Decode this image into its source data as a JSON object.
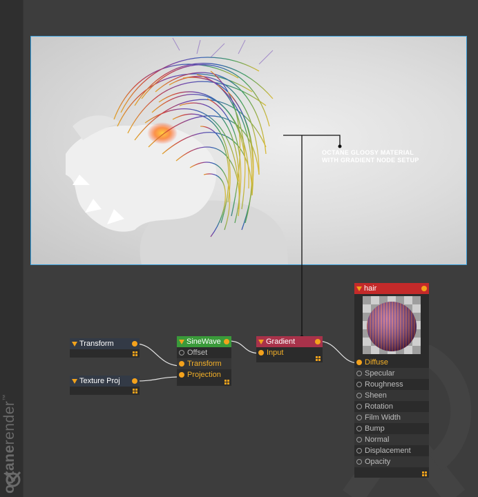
{
  "brand": {
    "name_bold": "octane",
    "name_light": "render",
    "mark": "™"
  },
  "render_view": {
    "annotation_line1": "OCTANE GLOOSY MATERIAL",
    "annotation_line2": "WITH GRADIENT NODE SETUP"
  },
  "nodes": {
    "transform": {
      "title": "Transform",
      "header_color": "#333a46"
    },
    "texture_proj": {
      "title": "Texture Proj",
      "header_color": "#333a46"
    },
    "sinewave": {
      "title": "SineWave",
      "header_color": "#3a9a3a",
      "ports": [
        {
          "label": "Offset",
          "connected": false
        },
        {
          "label": "Transform",
          "connected": true
        },
        {
          "label": "Projection",
          "connected": true
        }
      ]
    },
    "gradient": {
      "title": "Gradient",
      "header_color": "#a8324a",
      "ports": [
        {
          "label": "Input",
          "connected": true
        }
      ]
    },
    "hair": {
      "title": "hair",
      "header_color": "#c42a2a",
      "ports": [
        {
          "label": "Diffuse",
          "connected": true
        },
        {
          "label": "Specular",
          "connected": false
        },
        {
          "label": "Roughness",
          "connected": false
        },
        {
          "label": "Sheen",
          "connected": false
        },
        {
          "label": "Rotation",
          "connected": false
        },
        {
          "label": "Film Width",
          "connected": false
        },
        {
          "label": "Bump",
          "connected": false
        },
        {
          "label": "Normal",
          "connected": false
        },
        {
          "label": "Displacement",
          "connected": false
        },
        {
          "label": "Opacity",
          "connected": false
        }
      ]
    }
  },
  "colors": {
    "accent": "#f4a21c",
    "viewport_border": "#3aa0dc",
    "background": "#3d3d3d"
  }
}
